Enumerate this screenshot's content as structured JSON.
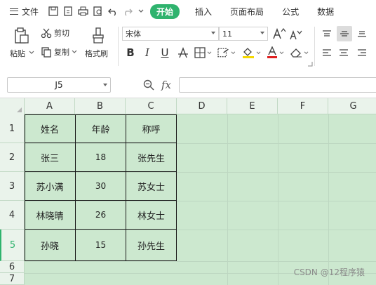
{
  "menubar": {
    "file_label": "文件",
    "tabs": [
      "开始",
      "插入",
      "页面布局",
      "公式",
      "数据"
    ],
    "active_tab": "开始"
  },
  "ribbon": {
    "paste_label": "粘贴",
    "cut_label": "剪切",
    "copy_label": "复制",
    "format_painter_label": "格式刷",
    "font_name": "宋体",
    "font_size": "11",
    "font_color": "#e02020",
    "fill_color": "#f5d800"
  },
  "formula_bar": {
    "name_box": "J5",
    "fx_label": "fx",
    "formula": ""
  },
  "sheet": {
    "columns": [
      "A",
      "B",
      "C",
      "D",
      "E",
      "F",
      "G"
    ],
    "rows": [
      "1",
      "2",
      "3",
      "4",
      "5",
      "6",
      "7"
    ],
    "selected_row": "5",
    "cells": [
      [
        "姓名",
        "年龄",
        "称呼"
      ],
      [
        "张三",
        "18",
        "张先生"
      ],
      [
        "苏小满",
        "30",
        "苏女士"
      ],
      [
        "林晓晴",
        "26",
        "林女士"
      ],
      [
        "孙晓",
        "15",
        "孙先生"
      ]
    ]
  },
  "watermark": "CSDN @12程序猿",
  "colors": {
    "accent": "#2fb36e",
    "sheet_bg": "#cce8cf"
  }
}
